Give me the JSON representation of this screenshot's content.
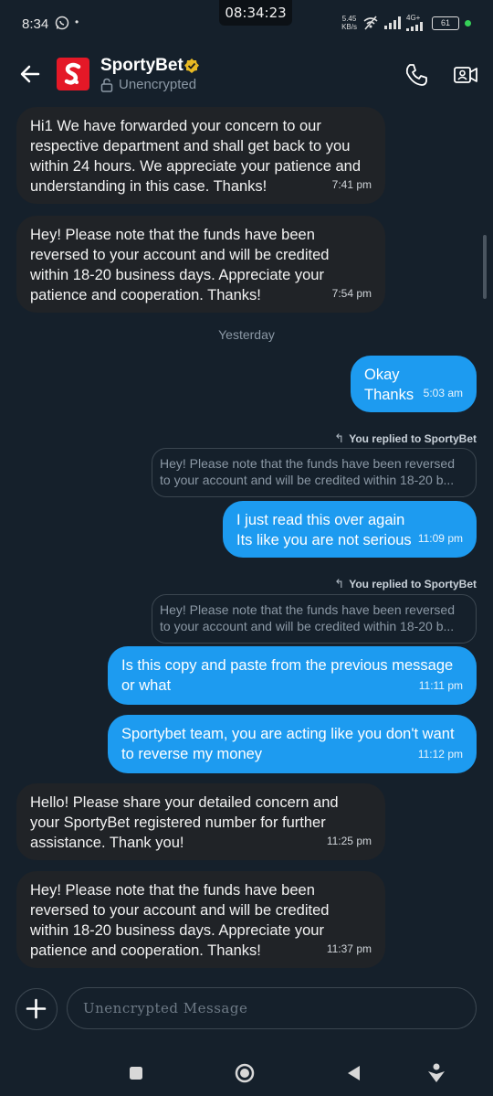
{
  "status_bar": {
    "time": "8:34",
    "clock": "08:34:23",
    "net_speed_value": "5.45",
    "net_speed_unit": "KB/s",
    "network": "4G+",
    "battery": "61"
  },
  "header": {
    "contact_name": "SportyBet",
    "encryption": "Unencrypted"
  },
  "messages": [
    {
      "text": "Hi1 We have forwarded your concern to our respective department and shall get back to you within 24 hours. We appreciate your patience and understanding in this case. Thanks!",
      "time": "7:41 pm"
    },
    {
      "text": "Hey! Please note that the funds have been reversed to your account and will be credited within 18-20 business days. Appreciate your patience and cooperation. Thanks!",
      "time": "7:54 pm"
    },
    {
      "text": "Okay\nThanks",
      "time": "5:03 am"
    },
    {
      "text": "I just read this over again\nIts like you are not serious",
      "time": "11:09 pm"
    },
    {
      "text": "Is this copy and paste from the previous message or what",
      "time": "11:11 pm"
    },
    {
      "text": "Sportybet team, you are acting like you don't want to reverse my money",
      "time": "11:12 pm"
    },
    {
      "text": "Hello! Please share your detailed concern and your SportyBet registered number for further assistance. Thank you!",
      "time": "11:25 pm"
    },
    {
      "text": "Hey! Please note that the funds have been reversed to your account and will be credited within 18-20 business days. Appreciate your patience and cooperation. Thanks!",
      "time": "11:37 pm"
    }
  ],
  "date_separator": "Yesterday",
  "replies": [
    {
      "label": "You replied to SportyBet",
      "line1": "Hey! Please note that the funds have been reversed",
      "line2": "to your account and will be credited within 18-20 b..."
    },
    {
      "label": "You replied to SportyBet",
      "line1": "Hey! Please note that the funds have been reversed",
      "line2": "to your account and will be credited within 18-20 b..."
    }
  ],
  "composer": {
    "placeholder": "Unencrypted Message"
  },
  "colors": {
    "background": "#15202b",
    "incoming_bubble": "#202327",
    "outgoing_bubble": "#1d9bf0",
    "brand": "#e41827",
    "verified": "#e8b923"
  },
  "icons": {
    "back": "back-arrow-icon",
    "call": "phone-icon",
    "video": "video-camera-icon",
    "add": "plus-icon",
    "lock": "lock-icon"
  }
}
